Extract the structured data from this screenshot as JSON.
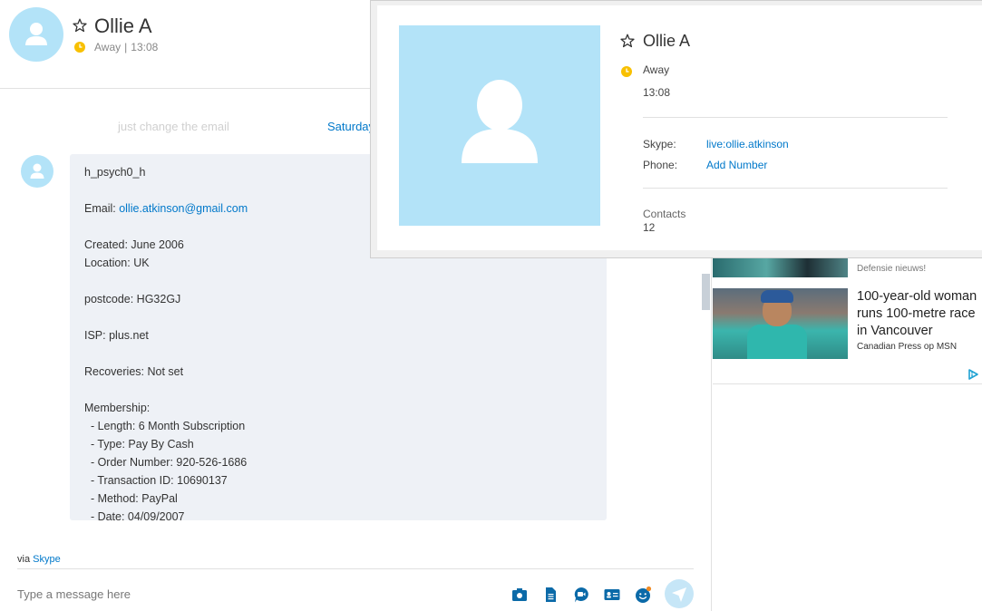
{
  "contact": {
    "name": "Ollie A",
    "status": "Away",
    "time": "13:08",
    "separator": "|"
  },
  "chat": {
    "prev_message": "just change the email",
    "date_label": "Saturday",
    "message_lines": [
      {
        "text": "h_psych0_h"
      },
      {
        "gap": true
      },
      {
        "text": "Email: ",
        "link": "ollie.atkinson@gmail.com"
      },
      {
        "gap": true
      },
      {
        "text": "Created: June 2006"
      },
      {
        "text": "Location: UK"
      },
      {
        "gap": true
      },
      {
        "text": "postcode: HG32GJ"
      },
      {
        "gap": true
      },
      {
        "text": "ISP: plus.net"
      },
      {
        "gap": true
      },
      {
        "text": "Recoveries: Not set"
      },
      {
        "gap": true
      },
      {
        "text": "Membership:"
      },
      {
        "text": "  - Length: 6 Month Subscription"
      },
      {
        "text": "  - Type: Pay By Cash"
      },
      {
        "text": "  - Order Number: 920-526-1686"
      },
      {
        "text": "  - Transaction ID: 10690137"
      },
      {
        "text": "  - Method: PayPal"
      },
      {
        "text": "  - Date: 04/09/2007"
      }
    ]
  },
  "footer": {
    "via_prefix": "via",
    "via_link": "Skype",
    "input_placeholder": "Type a message here",
    "tools": [
      "media-icon",
      "file-icon",
      "video-message-icon",
      "contact-card-icon",
      "emoticon-icon"
    ]
  },
  "profile": {
    "name": "Ollie A",
    "status": "Away",
    "time": "13:08",
    "skype_label": "Skype:",
    "skype_value": "live:ollie.atkinson",
    "phone_label": "Phone:",
    "phone_value": "Add Number",
    "contacts_label": "Contacts",
    "contacts_value": "12"
  },
  "news": {
    "item1_source": "Defensie nieuws!",
    "item2_title": "100-year-old woman runs 100-metre race in Vancouver",
    "item2_source": "Canadian Press op MSN"
  },
  "colors": {
    "accent": "#0078ca",
    "avatar_bg": "#b3e3f8",
    "away": "#f8c000",
    "bubble": "#eef1f6"
  }
}
